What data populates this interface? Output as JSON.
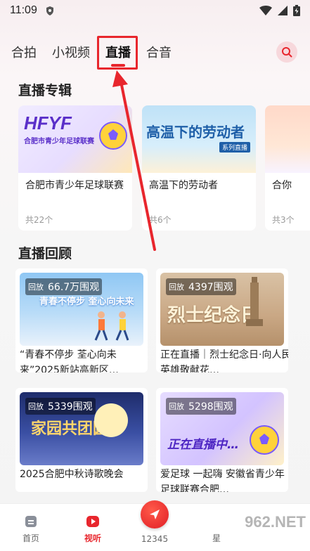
{
  "status_bar": {
    "time": "11:09"
  },
  "top_tabs": [
    {
      "label": "合拍",
      "active": false
    },
    {
      "label": "小视频",
      "active": false
    },
    {
      "label": "直播",
      "active": true
    },
    {
      "label": "合音",
      "active": false
    }
  ],
  "sections": {
    "albums_title": "直播专辑",
    "review_title": "直播回顾"
  },
  "albums": [
    {
      "cover_text": "HFYF",
      "cover_sub": "合肥市青少年足球联赛",
      "name": "合肥市青少年足球联赛",
      "count": "共22个"
    },
    {
      "cover_text": "高温下的劳动者",
      "cover_sub": "系列直播",
      "name": "高温下的劳动者",
      "count": "共6个"
    },
    {
      "cover_text": "",
      "cover_sub": "",
      "name": "合你",
      "count": "共3个"
    }
  ],
  "reviews": [
    {
      "badge": "回放",
      "views": "66.7万围观",
      "cover_text": "青春不停步 奎心向未来",
      "caption": "“青春不停步 荃心向未来”2025新站高新区…"
    },
    {
      "badge": "回放",
      "views": "4397围观",
      "cover_text": "烈士纪念日",
      "caption": "正在直播｜烈士纪念日·向人民英雄敬献花…"
    },
    {
      "badge": "回放",
      "views": "5339围观",
      "cover_text": "家园共团圆",
      "caption": "2025合肥中秋诗歌晚会"
    },
    {
      "badge": "回放",
      "views": "5298围观",
      "cover_text": "正在直播中…",
      "caption": "爱足球 一起嗨 安徽省青少年足球联赛合肥…"
    }
  ],
  "bottom_nav": [
    {
      "label": "首页",
      "active": false
    },
    {
      "label": "视听",
      "active": true
    },
    {
      "label": "12345",
      "active": false
    },
    {
      "label": "星",
      "active": false
    }
  ],
  "watermark": "962.NET",
  "colors": {
    "accent": "#e8262d"
  }
}
